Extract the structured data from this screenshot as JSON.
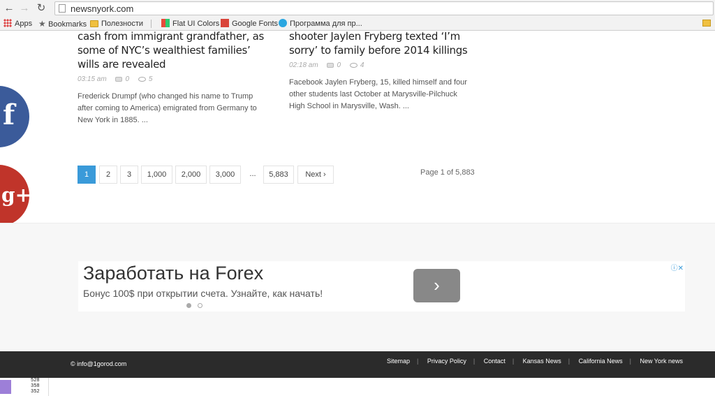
{
  "browser": {
    "url": "newsnyork.com",
    "bookmarks": [
      {
        "label": "Apps"
      },
      {
        "label": "Bookmarks"
      },
      {
        "label": "Полезности"
      },
      {
        "label": "Flat UI Colors"
      },
      {
        "label": "Google Fonts"
      },
      {
        "label": "Программа для пр..."
      }
    ]
  },
  "articles": [
    {
      "title": "cash from immigrant grandfather, as some of NYC’s wealthiest families’ wills are revealed",
      "time": "03:15 am",
      "comments": "0",
      "views": "5",
      "excerpt": "Frederick Drumpf (who changed his name to Trump after coming to America) emigrated from Germany to New York in 1885. ..."
    },
    {
      "title": "shooter Jaylen Fryberg texted ‘I’m sorry’ to family before 2014 killings",
      "time": "02:18 am",
      "comments": "0",
      "views": "4",
      "excerpt": "Facebook Jaylen Fryberg, 15, killed himself and four other students last October at Marysville-Pilchuck High School in Marysville, Wash. ..."
    }
  ],
  "social": {
    "facebook": "f",
    "google": "g+"
  },
  "pagination": {
    "pages": [
      "1",
      "2",
      "3",
      "1,000",
      "2,000",
      "3,000",
      "...",
      "5,883",
      "Next ›"
    ],
    "summary": "Page 1 of 5,883"
  },
  "ad": {
    "title": "Заработать на Forex",
    "text": "Бонус 100$ при открытии счета. Узнайте, как начать!",
    "button": "›"
  },
  "footer": {
    "email": "© info@1gorod.com",
    "links": [
      "Sitemap",
      "Privacy Policy",
      "Contact",
      "Kansas News",
      "California News",
      "New York news"
    ]
  },
  "status": {
    "n1": "528",
    "n2": "358",
    "n3": "352"
  }
}
